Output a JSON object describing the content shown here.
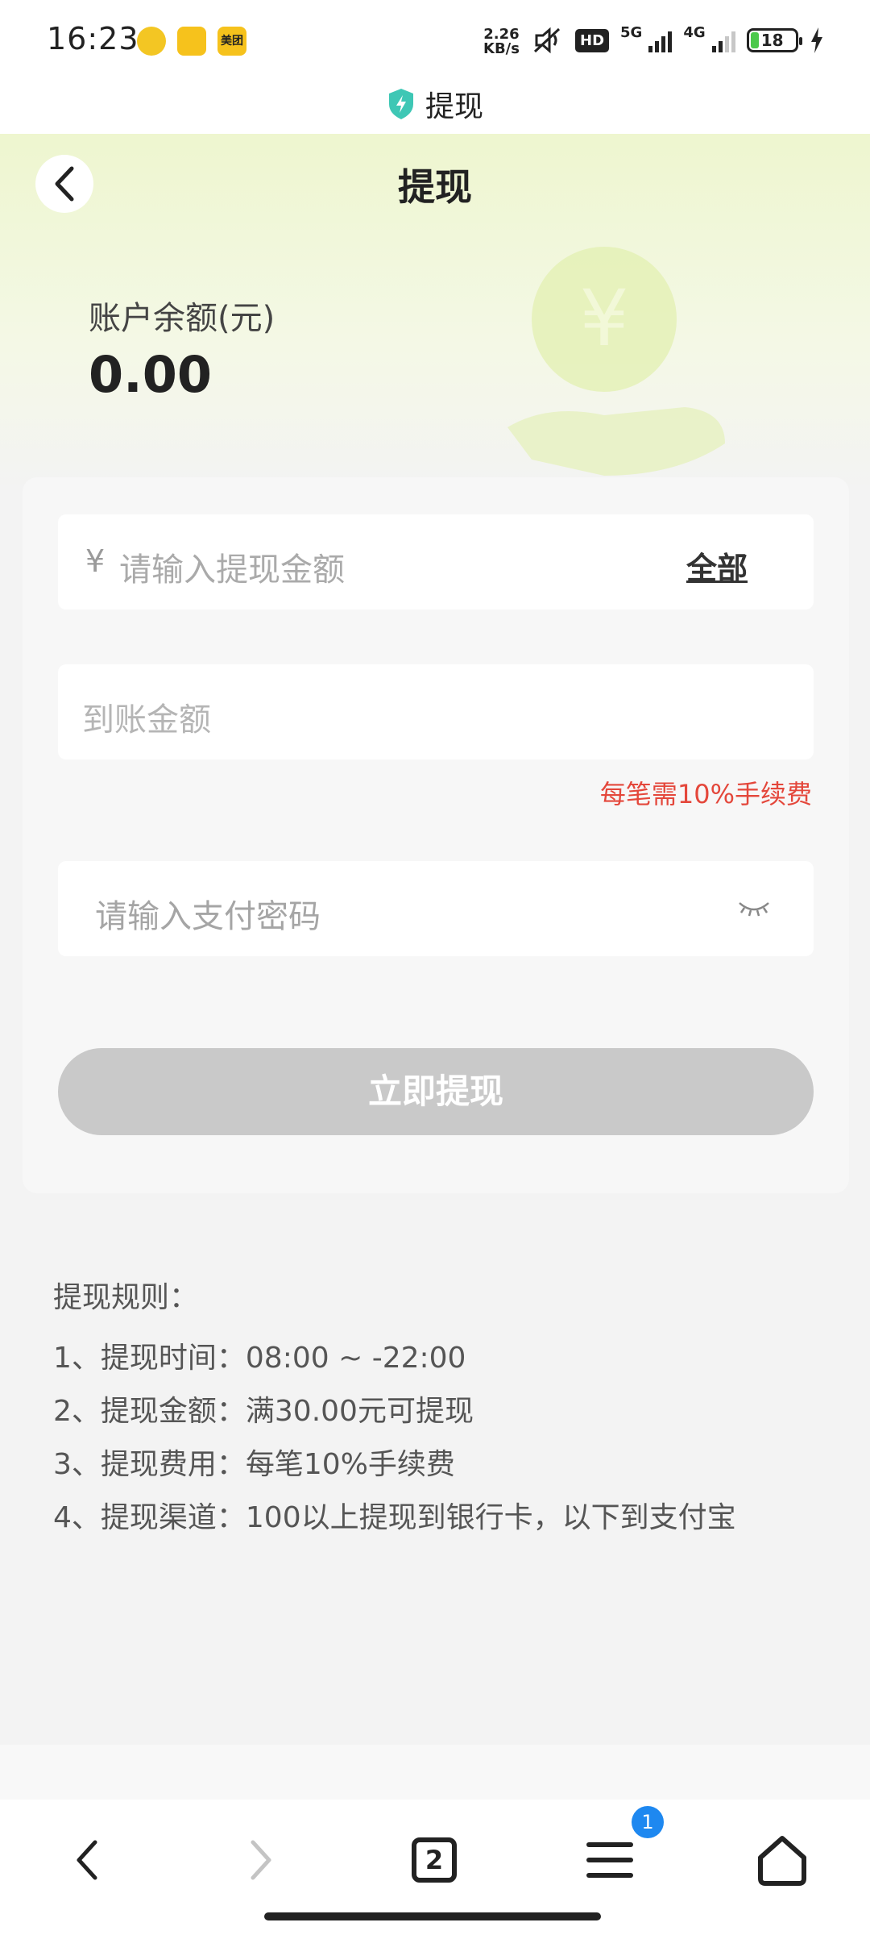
{
  "status_bar": {
    "time": "16:23",
    "net_speed_value": "2.26",
    "net_speed_unit": "KB/s",
    "hd_label": "HD",
    "signal1_label": "5G",
    "signal2_label": "4G",
    "battery": "18",
    "app_icons": [
      "music-app-icon",
      "ride-app-icon",
      "meituan-app-icon"
    ],
    "meituan_label": "美团"
  },
  "app_bar": {
    "title": "提现"
  },
  "header": {
    "page_title": "提现",
    "balance_label": "账户余额(元)",
    "balance_value": "0.00"
  },
  "form": {
    "currency_symbol": "¥",
    "amount_placeholder": "请输入提现金额",
    "all_button": "全部",
    "received_placeholder": "到账金额",
    "fee_note": "每笔需10%手续费",
    "password_placeholder": "请输入支付密码",
    "submit_label": "立即提现",
    "submit_color": "#c9c9c9"
  },
  "rules": {
    "title": "提现规则：",
    "items": [
      "1、提现时间：08:00 ~ -22:00",
      "2、提现金额：满30.00元可提现",
      "3、提现费用：每笔10%手续费",
      "4、提现渠道：100以上提现到银行卡，以下到支付宝"
    ]
  },
  "bottom_nav": {
    "tabs_count": "2",
    "menu_badge": "1"
  },
  "colors": {
    "accent_green": "#eef6cf",
    "warning_red": "#e4473b",
    "badge_blue": "#1e88f0"
  }
}
